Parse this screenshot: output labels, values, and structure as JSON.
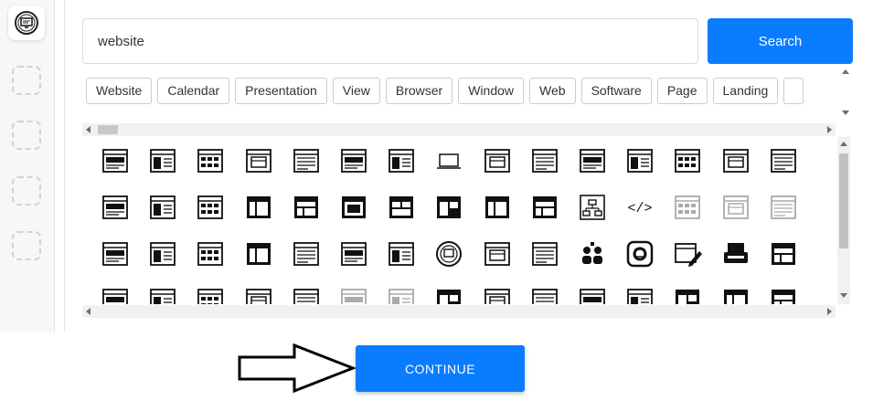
{
  "search": {
    "value": "website",
    "button_label": "Search"
  },
  "tags": [
    "Website",
    "Calendar",
    "Presentation",
    "View",
    "Browser",
    "Window",
    "Web",
    "Software",
    "Page",
    "Landing"
  ],
  "icon_rows": [
    [
      "website-sidebar-icon",
      "browser-bookmark-icon",
      "anchor-page-icon",
      "browser-window-icon",
      "home-page-icon",
      "document-browser-icon",
      "news-page-icon",
      "laptop-icon",
      "layout-grid-icon",
      "page-frame-icon",
      "list-page-icon",
      "box-window-icon",
      "music-page-icon",
      "image-page-icon",
      "text-page-icon"
    ],
    [
      "article-page-icon",
      "split-page-icon",
      "table-window-icon",
      "video-player-icon",
      "grid-layout-icon",
      "four-panel-icon",
      "sidebar-layout-icon",
      "three-column-icon",
      "dark-window-icon",
      "half-split-icon",
      "sitemap-icon",
      "code-icon",
      "video-outline-icon",
      "settings-window-icon",
      "heart-window-icon"
    ],
    [
      "list-window-icon",
      "video-gallery-icon",
      "circles-grid-icon",
      "stacked-windows-icon",
      "anchor-monitor-icon",
      "control-panel-icon",
      "portfolio-icon",
      "globe-badge-icon",
      "monitor-network-icon",
      "wireframe-icon",
      "people-network-icon",
      "settings-badge-icon",
      "edit-page-icon",
      "typewriter-icon",
      "dark-panel-icon"
    ],
    [
      "website-layout-icon",
      "wide-page-icon",
      "text-lines-icon",
      "document-lines-icon",
      "building-icon",
      "outline-window-icon",
      "faded-page-icon",
      "dark-browser-icon",
      "double-window-icon",
      "profile-page-icon",
      "image-window-icon",
      "columns-window-icon",
      "dark-layout-icon",
      "dark-window-alt-icon",
      "dark-frame-icon"
    ]
  ],
  "continue_label": "CONTINUE",
  "colors": {
    "accent": "#0a7cff",
    "icon": "#111111",
    "faded_icon": "#aaaaaa"
  }
}
